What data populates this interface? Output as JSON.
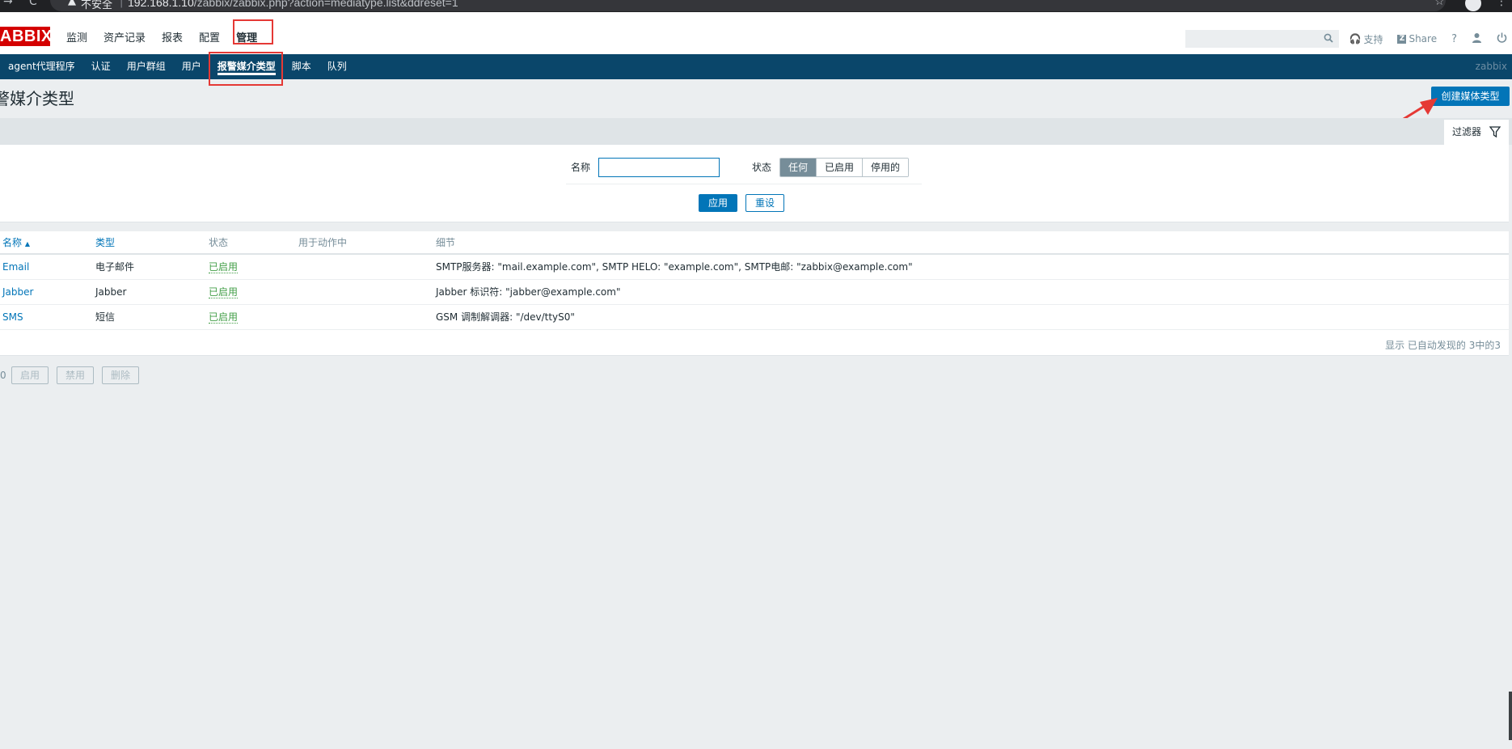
{
  "browser": {
    "nav_back": "→",
    "reload": "C",
    "warning_icon": "▲",
    "insecure_label": "不安全",
    "separator": "|",
    "url_host": "192.168.1.10",
    "url_path": "/zabbix/zabbix.php?action=mediatype.list&ddreset=1"
  },
  "header": {
    "logo": "ABBIX",
    "nav": [
      {
        "label": "监测"
      },
      {
        "label": "资产记录"
      },
      {
        "label": "报表"
      },
      {
        "label": "配置"
      },
      {
        "label": "管理"
      }
    ],
    "support_label": "支持",
    "share_label": "Share",
    "help_label": "?"
  },
  "subnav": {
    "items": [
      {
        "label": "agent代理程序"
      },
      {
        "label": "认证"
      },
      {
        "label": "用户群组"
      },
      {
        "label": "用户"
      },
      {
        "label": "报警媒介类型"
      },
      {
        "label": "脚本"
      },
      {
        "label": "队列"
      }
    ],
    "user": "zabbix"
  },
  "page": {
    "title": "警媒介类型",
    "create_button": "创建媒体类型"
  },
  "filter": {
    "tab_label": "过滤器",
    "name_label": "名称",
    "name_value": "",
    "status_label": "状态",
    "status_options": [
      "任何",
      "已启用",
      "停用的"
    ],
    "apply_label": "应用",
    "reset_label": "重设"
  },
  "table": {
    "headers": {
      "name": "名称",
      "type": "类型",
      "status": "状态",
      "used_in_actions": "用于动作中",
      "details": "细节"
    },
    "sort_arrow": "▲",
    "rows": [
      {
        "name": "Email",
        "type": "电子邮件",
        "status": "已启用",
        "actions": "",
        "details": "SMTP服务器: \"mail.example.com\", SMTP HELO: \"example.com\", SMTP电邮: \"zabbix@example.com\""
      },
      {
        "name": "Jabber",
        "type": "Jabber",
        "status": "已启用",
        "actions": "",
        "details": "Jabber 标识符: \"jabber@example.com\""
      },
      {
        "name": "SMS",
        "type": "短信",
        "status": "已启用",
        "actions": "",
        "details": "GSM 调制解调器: \"/dev/ttyS0\""
      }
    ],
    "footer": "显示 已自动发现的 3中的3"
  },
  "actions": {
    "selected_count": "0",
    "enable_label": "启用",
    "disable_label": "禁用",
    "delete_label": "删除"
  },
  "colors": {
    "accent": "#0275b8",
    "subnav_bg": "#0a466a",
    "enabled": "#429e47",
    "annotation": "#e53935"
  }
}
